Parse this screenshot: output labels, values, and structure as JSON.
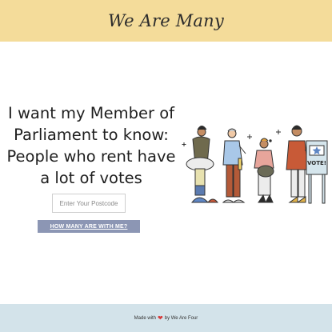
{
  "header": {
    "title": "We Are Many",
    "bg_color": "#f4dc9a"
  },
  "main": {
    "headline": "I want my Member of Parliament to know: People who rent have a lot of votes",
    "postcode": {
      "placeholder": "Enter Your Postcode",
      "value": ""
    },
    "cta_label": "HOW MANY ARE WITH ME?",
    "cta_color": "#8c96b4",
    "illustration": {
      "ballot_label": "VOTE!",
      "icon": "voters-queue-illustration"
    }
  },
  "footer": {
    "made_with": "Made with",
    "heart_icon": "heart-icon",
    "by": "by We Are Four",
    "bg_color": "#d3e3ea"
  }
}
